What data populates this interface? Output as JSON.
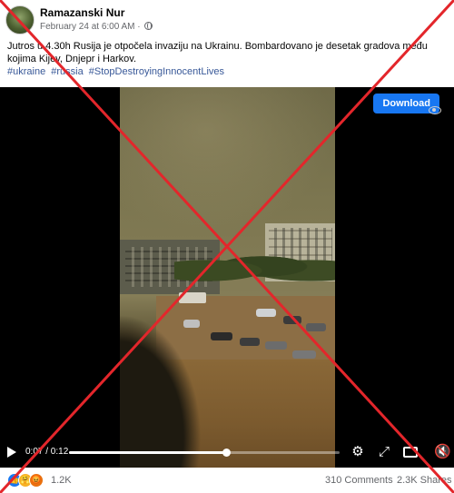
{
  "post": {
    "author": "Ramazanski Nur",
    "timestamp": "February 24 at 6:00 AM · ",
    "privacy_icon": "globe-icon",
    "text": "Jutros u 4.30h Rusija je otpočela invaziju na Ukrainu. Bombardovano je desetak gradova među kojima Kijev, Dnjepr i Harkov.",
    "hashtags": [
      "#ukraine",
      "#russia",
      "#StopDestroyingInnocentLives"
    ]
  },
  "video": {
    "download_label": "Download",
    "time": "0:07 / 0:12",
    "progress": 0.58,
    "icons": [
      "play-icon",
      "gear-icon",
      "expand-icon",
      "pip-icon",
      "volume-icon"
    ]
  },
  "footer": {
    "reaction_count": "1.2K",
    "comments": "310 Comments",
    "shares": "2.3K Shares",
    "reactions": [
      "like-icon",
      "care-icon",
      "angry-icon"
    ]
  },
  "overlay": {
    "cross_color": "#e3262b"
  },
  "colors": {
    "link": "#385898",
    "download": "#1877f2",
    "secondary_text": "#65676b"
  }
}
